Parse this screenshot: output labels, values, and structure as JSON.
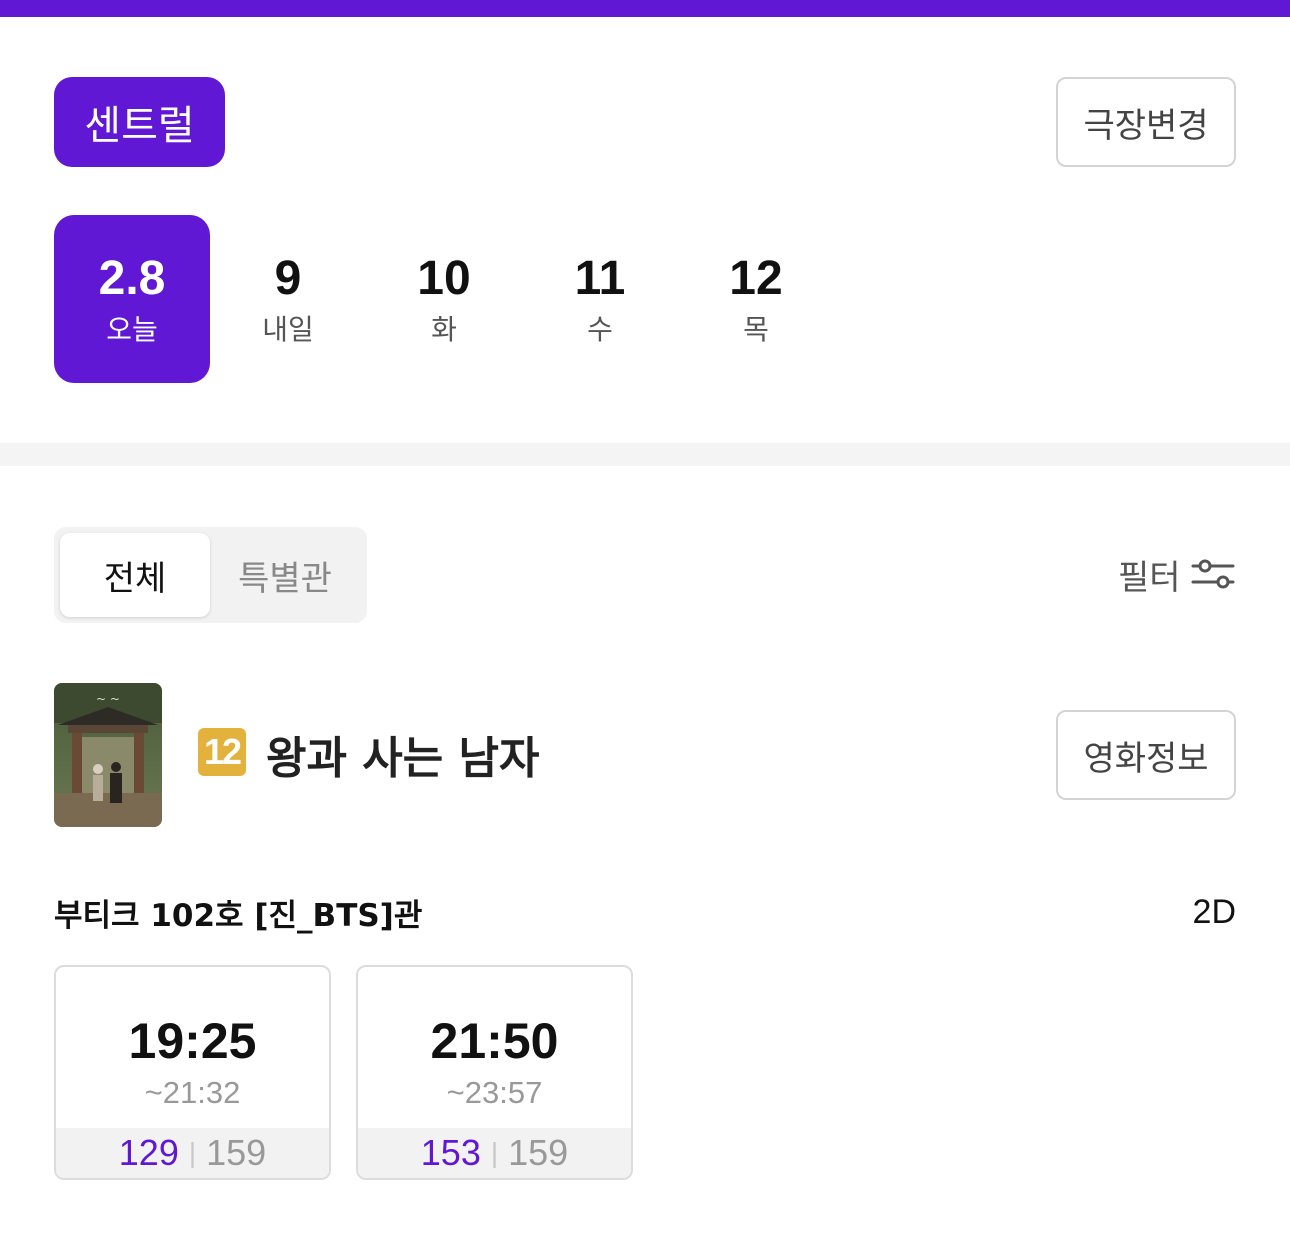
{
  "theater": {
    "name": "센트럴",
    "change_label": "극장변경"
  },
  "dates": [
    {
      "num": "2.8",
      "day": "오늘",
      "selected": true
    },
    {
      "num": "9",
      "day": "내일",
      "selected": false
    },
    {
      "num": "10",
      "day": "화",
      "selected": false
    },
    {
      "num": "11",
      "day": "수",
      "selected": false
    },
    {
      "num": "12",
      "day": "목",
      "selected": false
    }
  ],
  "tabs": {
    "all": "전체",
    "special": "특별관"
  },
  "filter": {
    "label": "필터",
    "icon": "sliders-icon"
  },
  "movie": {
    "rating": "12",
    "rating_color": "#e3b23c",
    "title": "왕과 사는 남자",
    "info_label": "영화정보"
  },
  "screen": {
    "name": "부티크 102호 [진_BTS]관",
    "format": "2D"
  },
  "showtimes": [
    {
      "start": "19:25",
      "end": "~21:32",
      "available": "129",
      "total": "159"
    },
    {
      "start": "21:50",
      "end": "~23:57",
      "available": "153",
      "total": "159"
    }
  ],
  "colors": {
    "accent": "#6018d4"
  }
}
